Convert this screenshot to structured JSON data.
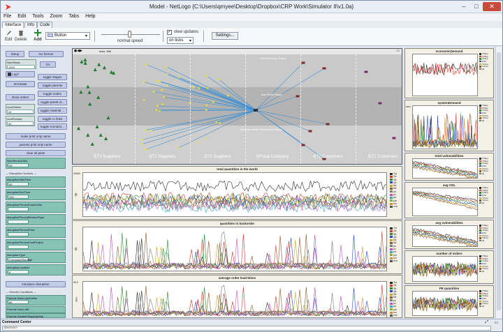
{
  "window": {
    "title": "Model - NetLogo {C:\\Users\\qmyee\\Desktop\\Dropbox\\CRP Work\\Simulator II\\v1.0a}"
  },
  "menu": [
    "File",
    "Edit",
    "Tools",
    "Zoom",
    "Tabs",
    "Help"
  ],
  "tabs": [
    "Interface",
    "Info",
    "Code"
  ],
  "toolbar": {
    "edit": "Edit",
    "delete": "Delete",
    "add": "Add",
    "widget_type": "Button",
    "speed": "normal speed",
    "view_updates": "view updates",
    "update_mode": "on ticks",
    "settings": "Settings..."
  },
  "left": {
    "setup": "Setup",
    "go_forever": "Go forever",
    "ticks_label": "NumSteps",
    "ticks_value": "1000",
    "go": "Go",
    "log": "Log?",
    "terminate": "terminate",
    "toggles": [
      "toggle stages",
      "toggle parents",
      "toggle nodes",
      "toggle paretl ol...",
      "toggle material ...",
      "toggle cc links",
      "toggle scenario..."
    ],
    "show_orders": "show orders",
    "numorders_label": "numOrders",
    "numorders_value": "40",
    "numperiods_label": "numPeriods",
    "numperiods_value": "30",
    "make_plots": "make print only name",
    "paretns_plots": "parents print only name",
    "clear_plots": "clear all plots",
    "rerun_label": "NumReruns/Sim",
    "rerun_value": "50",
    "disruption_header": "--- Disruption Controls ---",
    "disruption_fields": [
      {
        "label": "disruptionStartTime",
        "value": "50"
      },
      {
        "label": "disruptionEndTime",
        "value": "200"
      },
      {
        "label": "disruptionPercentCostOnNo",
        "value": ""
      },
      {
        "label": "disruptionPercentBookedType",
        "value": ""
      },
      {
        "label": "disruptionPercentFlow",
        "value": ""
      },
      {
        "label": "disruptionPercentCostProject",
        "value": ""
      },
      {
        "label": "disruptionType",
        "value": "CompanyShortage"
      },
      {
        "label": "disruptionLocation",
        "value": "0"
      }
    ],
    "intro_disruption": "introduce disruption",
    "smooth_header": "--- Smooth Conditions ---",
    "smooth_fields": [
      {
        "label": "Parents NumLotsSmiths",
        "value": "80"
      },
      {
        "label": "Parents NumLotD",
        "value": "p1n1n2n3n4n5n6"
      }
    ],
    "bottom_label": "Parents DisableShippingHelp"
  },
  "world": {
    "ticks": "ticks: 388",
    "stage_labels": [
      "0|T3 Suppliers",
      "1|T2 Suppliers",
      "2|T1 Suppliers",
      "3|Focal Company",
      "4|T1 Customers",
      "5|T2 Customers"
    ],
    "region_labels": [
      "Unlimited Group Region",
      "Asia Pacific Region",
      "Americas, Middle East & Africa Region"
    ]
  },
  "plots": {
    "main1": {
      "title": "total quantities in the world",
      "ymax": "20000",
      "ylabel": "qty"
    },
    "main2": {
      "title": "quantities in backorder",
      "ylabel": "qty"
    },
    "main3": {
      "title": "average order lead-times",
      "ymax": "99.2",
      "ylabel": "time"
    },
    "r1": {
      "title": "economicDemand"
    },
    "r2": {
      "title": "systemDemand",
      "ymax": "8000"
    },
    "r3": {
      "title": "total vulnerabilities"
    },
    "r4": {
      "title": "avg CDL"
    },
    "r5": {
      "title": "avg vulnerabilities"
    },
    "r6": {
      "title": "number of orders"
    },
    "r7": {
      "title": "PE quantities"
    },
    "legend_main": [
      "Tot",
      "2lz",
      "3lz",
      "4lz",
      "5lz",
      "6lz",
      "ps",
      "pv",
      "pa",
      "pm",
      "rcs",
      "rcm"
    ],
    "legend_r": [
      "T3Sup",
      "T2Sup",
      "T1Sup",
      "FOC",
      "T1Cus",
      "T2Cus",
      "all"
    ],
    "colors": [
      "#2a2a2a",
      "#d23b2b",
      "#2b8a2b",
      "#2448c9",
      "#c9a227",
      "#8b5a2b",
      "#7a7a7a",
      "#c04fc0",
      "#35a9b8",
      "#7fb52f",
      "#e08a2a",
      "#555555"
    ]
  },
  "command": {
    "label": "Command Center",
    "observer": "observer>"
  }
}
